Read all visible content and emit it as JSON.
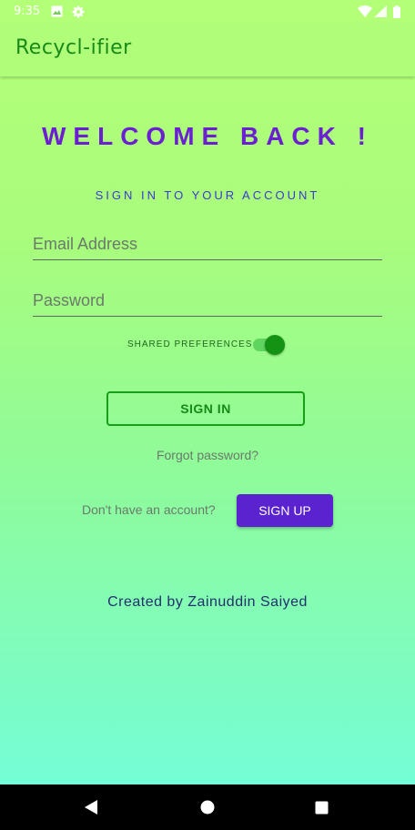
{
  "status_bar": {
    "time": "9:35",
    "icons": [
      "image-icon",
      "settings-gear-icon",
      "wifi-icon",
      "signal-icon",
      "battery-icon"
    ]
  },
  "app_bar": {
    "title": "Recycl-ifier"
  },
  "main": {
    "heading": "WELCOME BACK !",
    "subheading": "SIGN IN TO YOUR ACCOUNT",
    "email": {
      "placeholder": "Email Address",
      "value": ""
    },
    "password": {
      "placeholder": "Password",
      "value": ""
    },
    "shared_preferences": {
      "label": "SHARED PREFERENCES",
      "enabled": true
    },
    "sign_in_label": "SIGN IN",
    "forgot_password_label": "Forgot password?",
    "no_account_text": "Don't have an account?",
    "sign_up_label": "SIGN UP",
    "credit": "Created by Zainuddin Saiyed"
  },
  "nav_bar": {
    "buttons": [
      "back-icon",
      "home-icon",
      "recents-icon"
    ]
  },
  "colors": {
    "accent_purple": "#5b22d0",
    "heading_purple": "#6a1fd1",
    "primary_green": "#168a16",
    "gradient_top": "#b4ff78",
    "gradient_bottom": "#74fdd6"
  }
}
